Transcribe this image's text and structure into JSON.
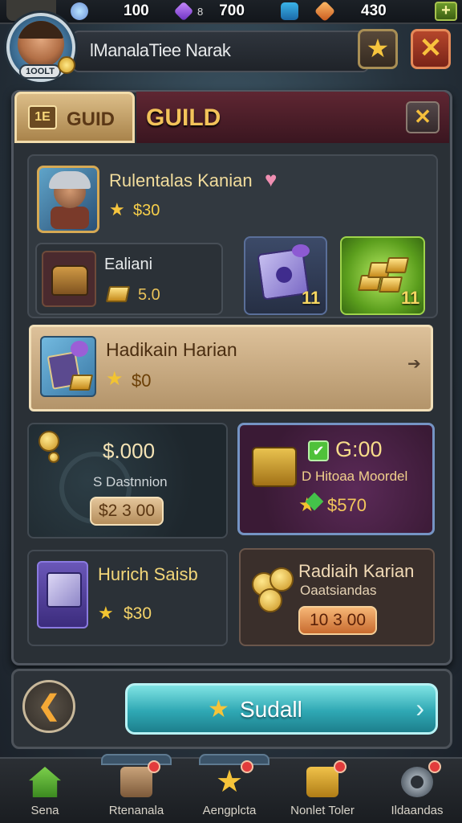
{
  "resources": [
    {
      "icon": "clover-icon",
      "prefix": "",
      "value": "100"
    },
    {
      "icon": "purple-gem-icon",
      "prefix": "8",
      "value": "700"
    },
    {
      "icon": "orange-gem-icon",
      "prefix": "",
      "value": "430"
    }
  ],
  "header": {
    "player_name": "lManalaTiee Narak",
    "avatar_tag": "1OOLT"
  },
  "tabs": {
    "guid_icon": "1E",
    "guid_label": "GUID",
    "guild_label": "GUILD"
  },
  "featured": {
    "title": "Rulentalas Kanian",
    "price": "$30"
  },
  "sub_item": {
    "title": "Ealiani",
    "price": "5.0"
  },
  "box_items": [
    {
      "qty": "11"
    },
    {
      "qty": "11"
    }
  ],
  "banner": {
    "title": "Hadikain Harian",
    "price": "$0"
  },
  "card_a": {
    "price": "$.000",
    "subtitle": "S Dastnnion",
    "button": "$2 3 00"
  },
  "card_b": {
    "time": "G:00",
    "subtitle": "D Hitoaa Moordel",
    "price": "$570"
  },
  "card_c": {
    "title": "Hurich Saisb",
    "price": "$30"
  },
  "card_d": {
    "title": "Radiaih Karian",
    "subtitle": "Oaatsiandas",
    "button": "10 3 00"
  },
  "footer": {
    "main_button": "Sudall"
  },
  "nav": [
    {
      "label": "Sena"
    },
    {
      "label": "Rtenanala"
    },
    {
      "label": "Aengplcta"
    },
    {
      "label": "Nonlet Toler"
    },
    {
      "label": "Ildaandas"
    }
  ],
  "colors": {
    "accent_gold": "#f3c35a",
    "guild_tab": "#5f2632",
    "main_button": "#2fa8b4",
    "close_red": "#b5462b"
  }
}
